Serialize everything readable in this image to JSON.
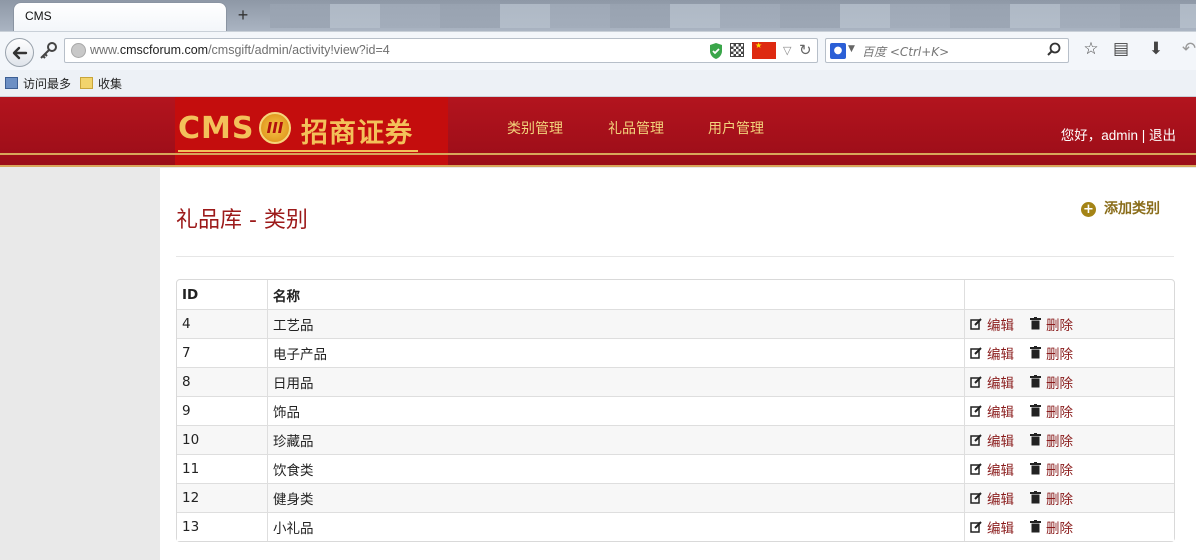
{
  "browser": {
    "tab_title": "CMS",
    "new_tab": "+",
    "url_prefix": "www.",
    "url_domain": "cmscforum.com",
    "url_path": "/cmsgift/admin/activity!view?id=4",
    "search_placeholder": "百度 <Ctrl+K>",
    "bookmarks": [
      {
        "label": "访问最多"
      },
      {
        "label": "收集"
      }
    ]
  },
  "header": {
    "logo_text": "CMS",
    "logo_badge": "III",
    "logo_brand": "招商证券",
    "nav": [
      {
        "label": "类别管理"
      },
      {
        "label": "礼品管理"
      },
      {
        "label": "用户管理"
      }
    ],
    "greeting": "您好，admin | 退出"
  },
  "main": {
    "title": "礼品库 - 类别",
    "add_label": "添加类别",
    "table": {
      "headers": [
        "ID",
        "名称",
        ""
      ],
      "edit_label": "编辑",
      "delete_label": "删除",
      "rows": [
        {
          "id": "4",
          "name": "工艺品"
        },
        {
          "id": "7",
          "name": "电子产品"
        },
        {
          "id": "8",
          "name": "日用品"
        },
        {
          "id": "9",
          "name": "饰品"
        },
        {
          "id": "10",
          "name": "珍藏品"
        },
        {
          "id": "11",
          "name": "饮食类"
        },
        {
          "id": "12",
          "name": "健身类"
        },
        {
          "id": "13",
          "name": "小礼品"
        }
      ]
    }
  },
  "colors": {
    "header_red": "#b3141e",
    "accent_gold": "#f3c15a",
    "title_red": "#9c1a1a",
    "action_red": "#8a1c1c"
  }
}
